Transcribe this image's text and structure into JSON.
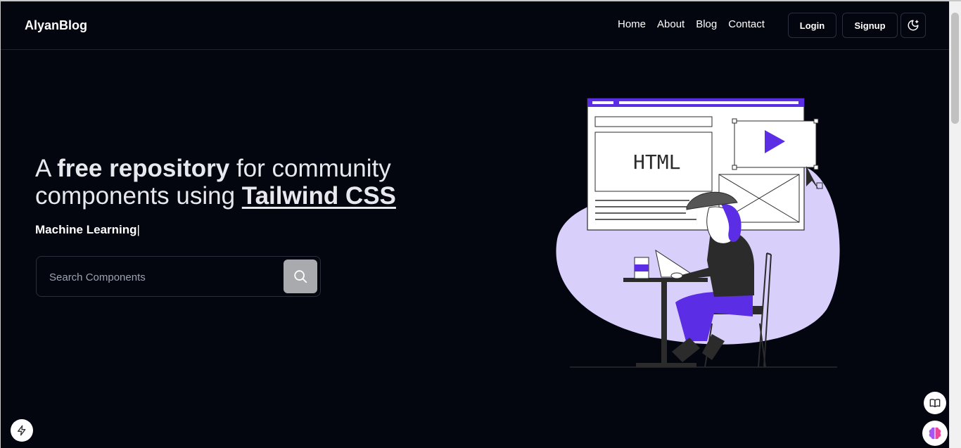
{
  "nav": {
    "brand": "AlyanBlog",
    "links": [
      {
        "label": "Home"
      },
      {
        "label": "About"
      },
      {
        "label": "Blog"
      },
      {
        "label": "Contact"
      }
    ],
    "login_label": "Login",
    "signup_label": "Signup",
    "theme_icon": "moon-sparkle-icon"
  },
  "hero": {
    "title_part1": "A ",
    "title_bold": "free repository",
    "title_part2": " for community components using ",
    "title_link": "Tailwind CSS",
    "typed_text": "Machine Learning",
    "caret": "|"
  },
  "search": {
    "placeholder": "Search Components",
    "value": "",
    "button_icon": "search-icon"
  },
  "illustration": {
    "html_label": "HTML"
  },
  "floating": {
    "left_icon": "bolt-icon",
    "right_top_icon": "book-icon",
    "right_bottom_icon": "brain-icon"
  },
  "colors": {
    "background": "#03050f",
    "accent_purple": "#5b2ee6",
    "lavender": "#d9cffb",
    "search_button": "#a9aaad"
  }
}
